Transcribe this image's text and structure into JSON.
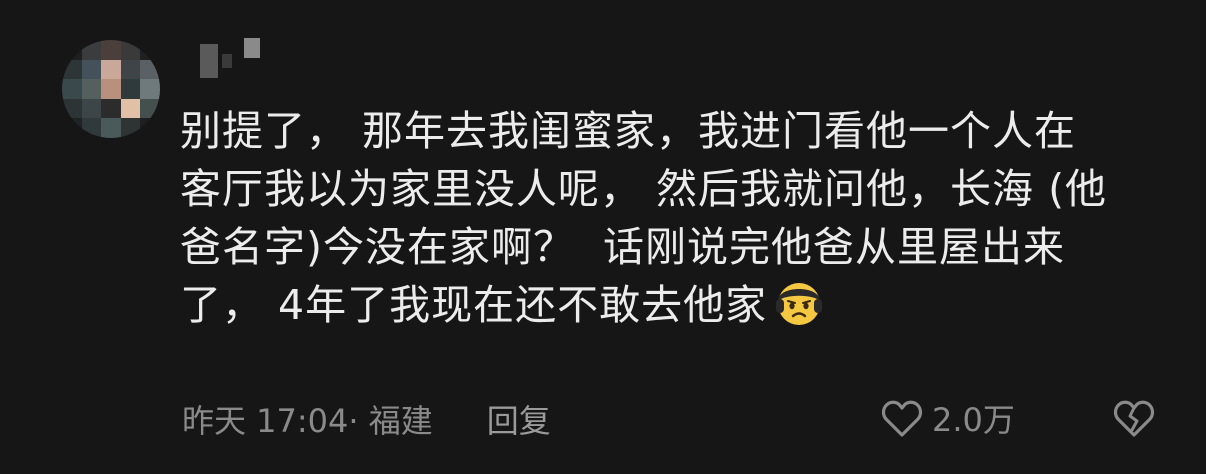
{
  "comment": {
    "lines": [
      "别提了， 那年去我闺蜜家，我进门看他一个人在",
      "客厅我以为家里没人呢， 然后我就问他，长海 (他",
      "爸名字)今没在家啊？  话刚说完他爸从里屋出来",
      "了， 4年了我现在还不敢去他家"
    ],
    "emoji": "worried-face-icon"
  },
  "meta": {
    "time_location": "昨天 17:04· 福建",
    "reply_label": "回复"
  },
  "actions": {
    "like_count": "2.0万",
    "like_icon": "heart-outline-icon",
    "dislike_icon": "broken-heart-icon"
  },
  "colors": {
    "background": "#161616",
    "text": "#ececec",
    "meta": "#8a8a8a"
  }
}
